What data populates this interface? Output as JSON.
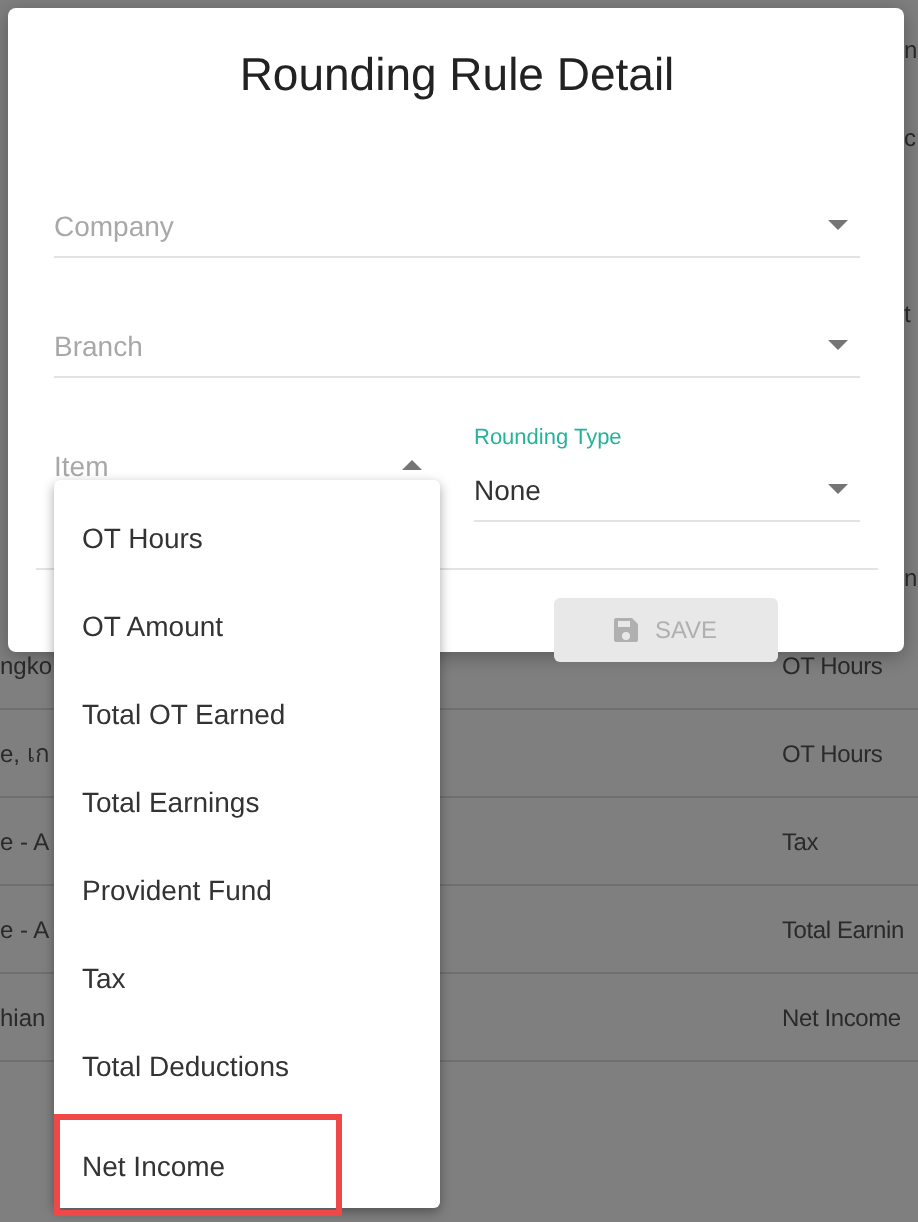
{
  "background_table": {
    "rows_behind_dialog": [
      {
        "column_2": "n"
      },
      {
        "column_2": "c"
      },
      {
        "column_2": "t"
      },
      {
        "column_2": "n"
      }
    ],
    "rows": [
      {
        "column_1": "ngko",
        "column_2": "OT Hours"
      },
      {
        "column_1": "e, เก",
        "column_2": "OT Hours"
      },
      {
        "column_1": "e - A",
        "column_2": "Tax"
      },
      {
        "column_1": "e - A",
        "column_2": "Total Earnin"
      },
      {
        "column_1": "hian",
        "column_2": "Net Income"
      }
    ]
  },
  "dialog": {
    "title": "Rounding Rule Detail",
    "company": {
      "placeholder": "Company"
    },
    "branch": {
      "placeholder": "Branch"
    },
    "item": {
      "placeholder": "Item",
      "expanded": true
    },
    "rounding_type": {
      "label": "Rounding Type",
      "value": "None",
      "expanded": false
    },
    "save_button": {
      "label": "SAVE",
      "disabled": true
    }
  },
  "item_menu": {
    "options": [
      {
        "label": "OT Hours",
        "highlighted": false
      },
      {
        "label": "OT Amount",
        "highlighted": false
      },
      {
        "label": "Total OT Earned",
        "highlighted": false
      },
      {
        "label": "Total Earnings",
        "highlighted": false
      },
      {
        "label": "Provident Fund",
        "highlighted": false
      },
      {
        "label": "Tax",
        "highlighted": false
      },
      {
        "label": "Total Deductions",
        "highlighted": false
      },
      {
        "label": "Net Income",
        "highlighted": true
      }
    ]
  }
}
